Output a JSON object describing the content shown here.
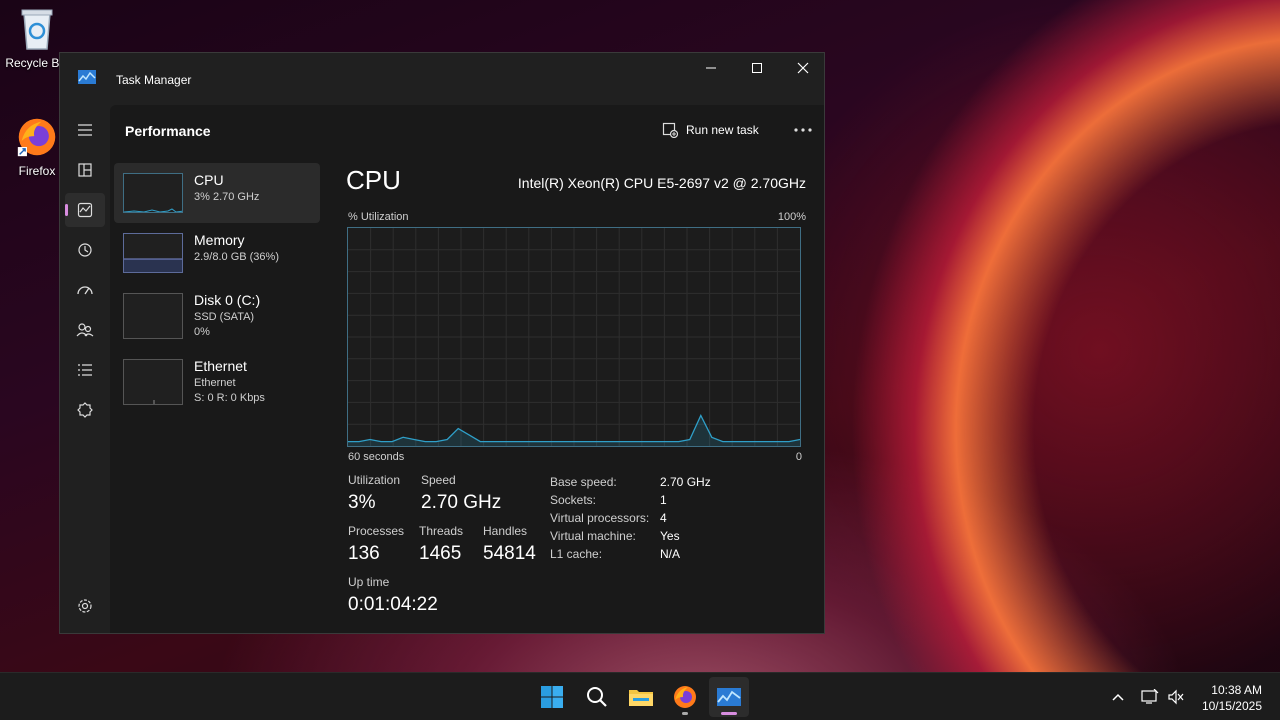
{
  "desktop": {
    "icons": [
      {
        "label": "Recycle Bin"
      },
      {
        "label": "Firefox"
      }
    ]
  },
  "window": {
    "title": "Task Manager",
    "controls": {
      "minimize": "—",
      "maximize": "☐",
      "close": "✕"
    }
  },
  "header": {
    "page_title": "Performance",
    "run_new_task": "Run new task"
  },
  "nav": {
    "items": [
      "menu-icon",
      "processes-icon",
      "performance-icon",
      "app-history-icon",
      "startup-apps-icon",
      "users-icon",
      "details-icon",
      "services-icon"
    ],
    "active": "performance-icon",
    "settings": "settings-icon"
  },
  "sidebar": {
    "items": [
      {
        "name": "CPU",
        "line1": "3% 2.70 GHz",
        "line2": ""
      },
      {
        "name": "Memory",
        "line1": "2.9/8.0 GB (36%)",
        "line2": ""
      },
      {
        "name": "Disk 0 (C:)",
        "line1": "SSD (SATA)",
        "line2": "0%"
      },
      {
        "name": "Ethernet",
        "line1": "Ethernet",
        "line2": "S: 0 R: 0 Kbps"
      }
    ]
  },
  "cpu": {
    "title": "CPU",
    "model": "Intel(R) Xeon(R) CPU E5-2697 v2 @ 2.70GHz",
    "util_label": "% Utilization",
    "util_max": "100%",
    "time_span": "60 seconds",
    "time_end": "0",
    "utilization": {
      "label": "Utilization",
      "value": "3%"
    },
    "speed": {
      "label": "Speed",
      "value": "2.70 GHz"
    },
    "processes": {
      "label": "Processes",
      "value": "136"
    },
    "threads": {
      "label": "Threads",
      "value": "1465"
    },
    "handles": {
      "label": "Handles",
      "value": "54814"
    },
    "uptime": {
      "label": "Up time",
      "value": "0:01:04:22"
    },
    "specs": [
      {
        "key": "Base speed:",
        "value": "2.70 GHz"
      },
      {
        "key": "Sockets:",
        "value": "1"
      },
      {
        "key": "Virtual processors:",
        "value": "4"
      },
      {
        "key": "Virtual machine:",
        "value": "Yes"
      },
      {
        "key": "L1 cache:",
        "value": "N/A"
      }
    ]
  },
  "chart_data": {
    "type": "area",
    "y": [
      2,
      2,
      3,
      2,
      2,
      4,
      3,
      2,
      2,
      3,
      8,
      5,
      2,
      2,
      2,
      2,
      2,
      2,
      2,
      2,
      2,
      2,
      2,
      2,
      2,
      2,
      2,
      2,
      2,
      2,
      2,
      3,
      14,
      4,
      2,
      2,
      2,
      2,
      2,
      2,
      2,
      3
    ],
    "ylim": [
      0,
      100
    ],
    "xlabel": "60 seconds",
    "ylabel": "% Utilization"
  },
  "taskbar": {
    "items": [
      "start-icon",
      "search-icon",
      "file-explorer-icon",
      "firefox-icon",
      "task-manager-icon"
    ],
    "time": "10:38 AM",
    "date": "10/15/2025"
  },
  "colors": {
    "accent": "#d88de0",
    "graph_line": "#2f9fc8",
    "graph_border": "#3f6e84"
  }
}
